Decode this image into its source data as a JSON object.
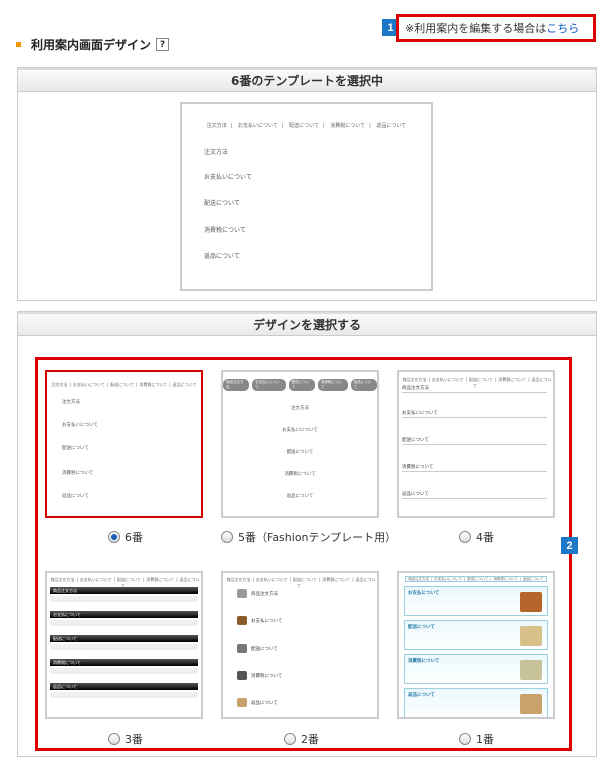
{
  "header": {
    "section_title": "利用案内画面デザイン",
    "help_label": "?",
    "edit_note_prefix": "※利用案内を編集する場合は",
    "edit_note_link": "こちら",
    "badge_1": "1",
    "badge_2": "2"
  },
  "current_panel": {
    "title": "6番のテンプレートを選択中",
    "nav": [
      "注文方法",
      "お支払いについて",
      "配送について",
      "消費税について",
      "返品について"
    ],
    "items": [
      "注文方法",
      "お支払いについて",
      "配送について",
      "消費税について",
      "返品について"
    ]
  },
  "design_panel": {
    "title": "デザインを選択する",
    "templates": [
      {
        "label": "6番",
        "selected": true
      },
      {
        "label": "5番（Fashionテンプレート用）",
        "selected": false
      },
      {
        "label": "4番",
        "selected": false
      },
      {
        "label": "3番",
        "selected": false
      },
      {
        "label": "2番",
        "selected": false
      },
      {
        "label": "1番",
        "selected": false
      }
    ],
    "thumb_nav_short": [
      "商品注文方法",
      "お支払いについて",
      "配送について",
      "消費税について",
      "返品について"
    ],
    "thumb_items_short": [
      "商品注文方法",
      "お支払いについて",
      "配送について",
      "消費税について",
      "返品について"
    ],
    "t1_items": [
      "お支払について",
      "配送について",
      "消費税について",
      "返品について"
    ],
    "t2_items": [
      "商品注文方法",
      "お支払について",
      "配送について",
      "消費税について",
      "返品について"
    ]
  },
  "colors": {
    "highlight_red": "#dd0000",
    "badge_blue": "#1d78c8",
    "link_blue": "#0a55c5",
    "bullet_orange": "#f39800"
  }
}
